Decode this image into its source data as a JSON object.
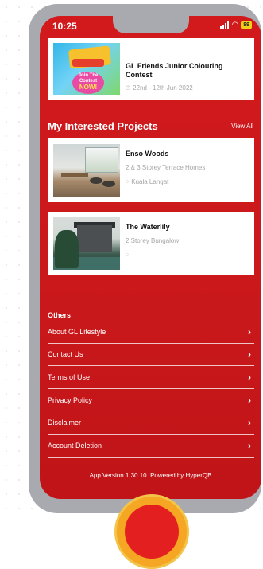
{
  "status_bar": {
    "time": "10:25",
    "battery": "89"
  },
  "events": {
    "card": {
      "title": "GL Friends Junior Colouring Contest",
      "date": "22nd - 12th Jun 2022",
      "thumb_text": {
        "line1": "Join The",
        "line2": "Contest",
        "line3": "NOW!"
      }
    }
  },
  "interested_projects": {
    "title": "My Interested Projects",
    "view_all_label": "View All",
    "items": [
      {
        "name": "Enso Woods",
        "type": "2 & 3 Storey Terrace Homes",
        "location": "Kuala Langat"
      },
      {
        "name": "The Waterlily",
        "type": "2 Storey Bungalow",
        "location": ""
      }
    ]
  },
  "others": {
    "label": "Others",
    "items": [
      {
        "label": "About GL Lifestyle"
      },
      {
        "label": "Contact Us"
      },
      {
        "label": "Terms of Use"
      },
      {
        "label": "Privacy Policy"
      },
      {
        "label": "Disclaimer"
      },
      {
        "label": "Account Deletion"
      }
    ]
  },
  "footer": {
    "app_version": "App Version 1.30.10. Powered by HyperQB"
  },
  "colors": {
    "brand_red": "#d21a1d",
    "fab_orange": "#f5a623"
  },
  "icons": {
    "calendar": "calendar-icon",
    "location": "location-pin-icon",
    "chevron": "chevron-right-icon"
  }
}
